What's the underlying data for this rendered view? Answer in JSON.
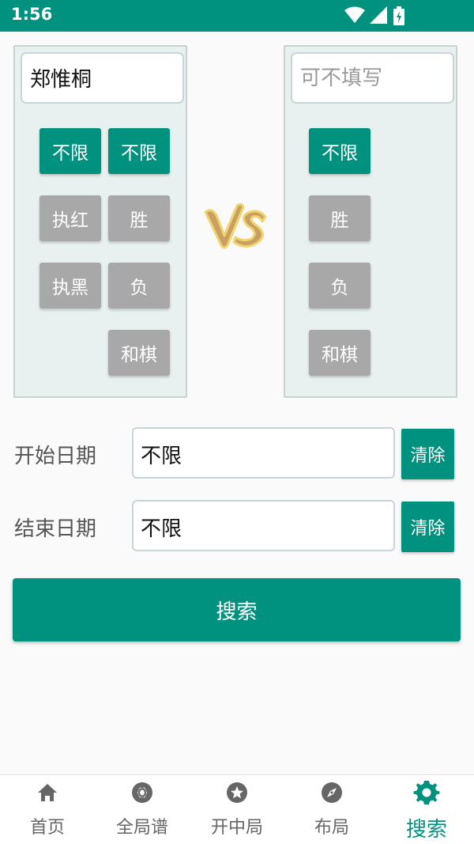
{
  "status_bar": {
    "time": "1:56"
  },
  "left_panel": {
    "player_input_value": "郑惟桐",
    "column1": [
      "不限",
      "执红",
      "执黑"
    ],
    "column2": [
      "不限",
      "胜",
      "负",
      "和棋"
    ]
  },
  "right_panel": {
    "player_input_placeholder": "可不填写",
    "options": [
      "不限",
      "胜",
      "负",
      "和棋"
    ]
  },
  "dates": {
    "start_label": "开始日期",
    "start_value": "不限",
    "end_label": "结束日期",
    "end_value": "不限",
    "clear_label": "清除"
  },
  "search_button": "搜索",
  "nav": {
    "items": [
      {
        "label": "首页",
        "icon": "home-icon"
      },
      {
        "label": "全局谱",
        "icon": "aperture-icon"
      },
      {
        "label": "开中局",
        "icon": "star-circle-icon"
      },
      {
        "label": "布局",
        "icon": "compass-icon"
      },
      {
        "label": "搜索",
        "icon": "gear-icon"
      }
    ],
    "active_index": 4
  },
  "colors": {
    "accent": "#00927f",
    "chip_off": "#a8a8a8",
    "panel_bg": "#e8f1ef"
  }
}
